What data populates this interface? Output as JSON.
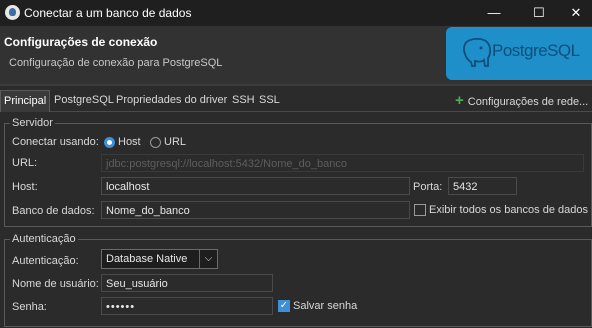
{
  "window": {
    "title": "Conectar a um banco de dados",
    "minimize_glyph": "—",
    "maximize_glyph": "☐",
    "close_glyph": "✕"
  },
  "header": {
    "title": "Configurações de conexão",
    "subtitle": "Configuração de conexão para PostgreSQL",
    "banner_text": "PostgreSQL"
  },
  "tabs": [
    {
      "label": "Principal",
      "active": true
    },
    {
      "label": "PostgreSQL",
      "active": false
    },
    {
      "label": "Propriedades do driver",
      "active": false
    },
    {
      "label": "SSH",
      "active": false
    },
    {
      "label": "SSL",
      "active": false
    }
  ],
  "network_button": {
    "label": "Configurações de rede..."
  },
  "server": {
    "legend": "Servidor",
    "connect_using_label": "Conectar usando:",
    "host_radio_label": "Host",
    "url_radio_label": "URL",
    "selected": "Host",
    "url_label": "URL:",
    "url_value": "jdbc:postgresql://localhost:5432/Nome_do_banco",
    "host_label": "Host:",
    "host_value": "localhost",
    "port_label": "Porta:",
    "port_value": "5432",
    "db_label": "Banco de dados:",
    "db_value": "Nome_do_banco",
    "show_all_label": "Exibir todos os bancos de dados",
    "show_all_checked": false
  },
  "auth": {
    "legend": "Autenticação",
    "auth_label": "Autenticação:",
    "auth_value": "Database Native",
    "user_label": "Nome de usuário:",
    "user_value": "Seu_usuário",
    "password_label": "Senha:",
    "password_value": "••••••",
    "save_password_label": "Salvar senha",
    "save_password_checked": true
  },
  "colors": {
    "accent": "#3d8fd6",
    "banner": "#1f8fc9",
    "plus": "#4caf50"
  }
}
